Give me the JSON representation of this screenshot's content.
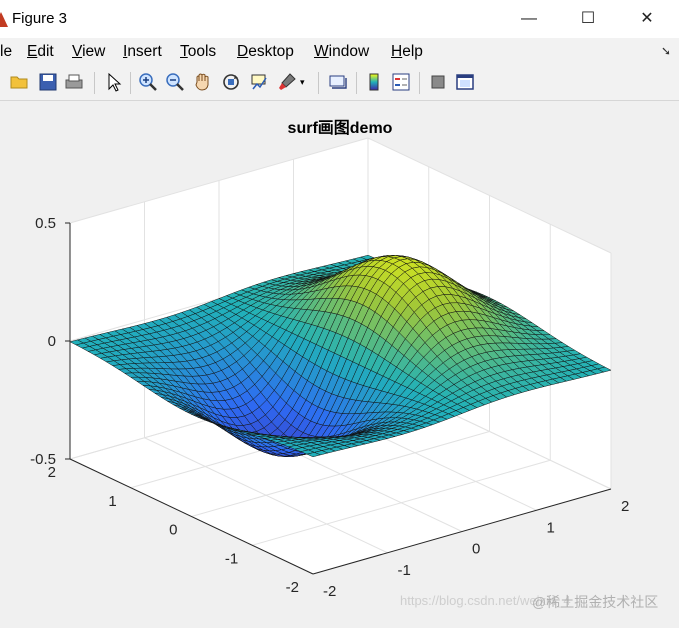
{
  "window": {
    "title": "Figure 3",
    "minimize": "—",
    "maximize": "☐",
    "close": "✕"
  },
  "menu": {
    "items": [
      {
        "label": "le",
        "u": ""
      },
      {
        "label": "dit",
        "u": "E"
      },
      {
        "label": "iew",
        "u": "V"
      },
      {
        "label": "nsert",
        "u": "I"
      },
      {
        "label": "ools",
        "u": "T"
      },
      {
        "label": "esktop",
        "u": "D"
      },
      {
        "label": "indow",
        "u": "W"
      },
      {
        "label": "elp",
        "u": "H"
      }
    ],
    "overflow_arrow": "➘"
  },
  "toolbar": {
    "icons": [
      "open-folder-icon",
      "save-icon",
      "print-icon",
      "pointer-icon",
      "zoom-in-icon",
      "zoom-out-icon",
      "pan-hand-icon",
      "rotate-3d-icon",
      "data-cursor-icon",
      "brush-icon",
      "link-plot-icon",
      "colorbar-icon",
      "legend-icon",
      "hide-plot-tools-icon",
      "show-plot-tools-icon"
    ]
  },
  "chart_data": {
    "type": "surface",
    "title": "surf画图demo",
    "x": [
      -2,
      -1,
      0,
      1,
      2
    ],
    "y": [
      -2,
      -1,
      0,
      1,
      2
    ],
    "z_ticks": [
      -0.5,
      0,
      0.5
    ],
    "zlim": [
      -0.5,
      0.5
    ],
    "colormap": "parula",
    "colors": {
      "low": "#3d26a8",
      "mid": "#21b1b9",
      "high": "#f9fb0e"
    },
    "function_shape": "peak near (x=0.5, y=0.0) ≈ +0.45; trough near (x=-0.5, y=0.0) ≈ -0.45; flat ≈0 at edges",
    "grid": true
  },
  "footer": {
    "watermark": "https://blog.csdn.net/weixin_4",
    "brand": "@稀土掘金技术社区"
  }
}
